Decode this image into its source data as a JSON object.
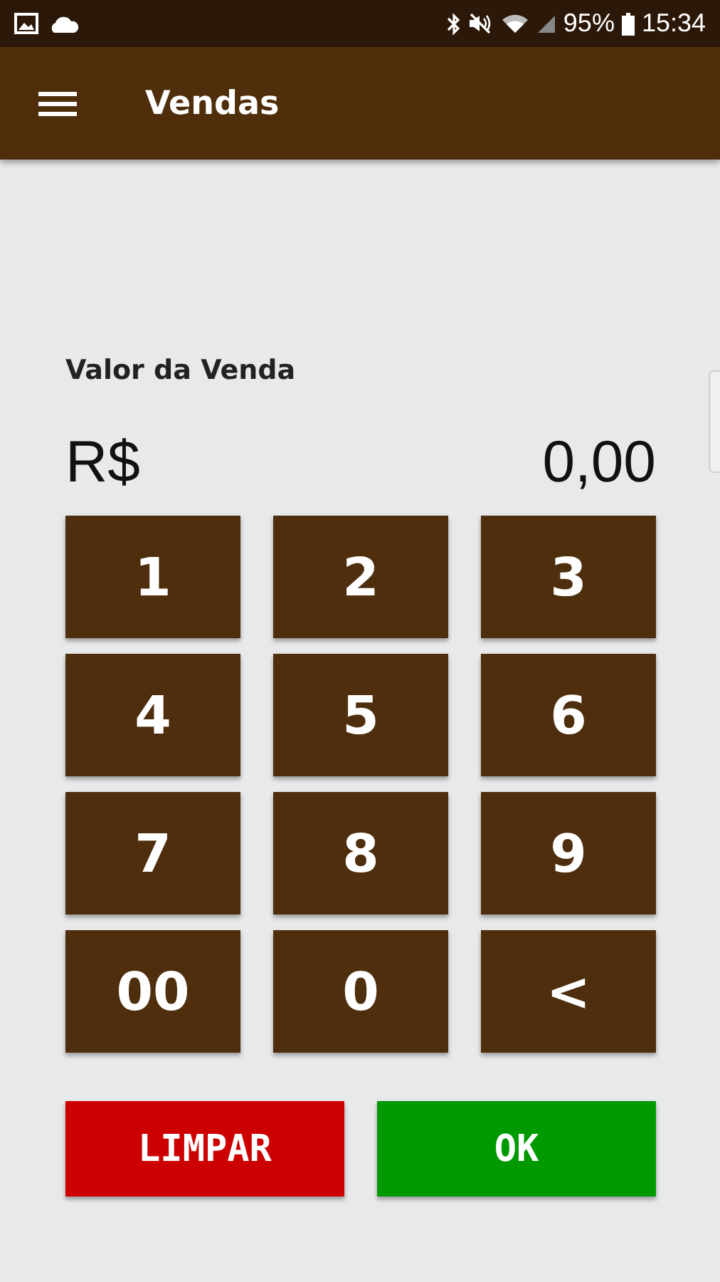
{
  "status_bar": {
    "battery": "95%",
    "time": "15:34"
  },
  "app_bar": {
    "title": "Vendas"
  },
  "sale": {
    "label": "Valor da Venda",
    "currency": "R$",
    "amount": "0,00"
  },
  "keypad": [
    "1",
    "2",
    "3",
    "4",
    "5",
    "6",
    "7",
    "8",
    "9",
    "00",
    "0",
    "<"
  ],
  "actions": [
    {
      "label": "LIMPAR",
      "kind": "clear"
    },
    {
      "label": "OK",
      "kind": "confirm"
    }
  ]
}
